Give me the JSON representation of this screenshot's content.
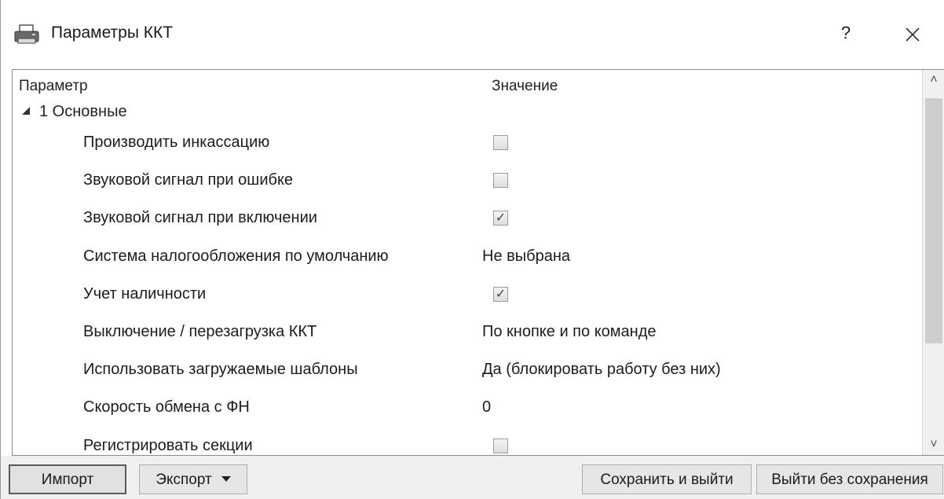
{
  "window": {
    "title": "Параметры ККТ",
    "help_label": "?"
  },
  "grid": {
    "columns": {
      "param": "Параметр",
      "value": "Значение"
    },
    "group": {
      "label": "1 Основные"
    },
    "rows": [
      {
        "label": "Производить инкассацию",
        "type": "checkbox",
        "checked": false
      },
      {
        "label": "Звуковой сигнал при ошибке",
        "type": "checkbox",
        "checked": false
      },
      {
        "label": "Звуковой сигнал при включении",
        "type": "checkbox",
        "checked": true
      },
      {
        "label": "Система налогообложения по умолчанию",
        "type": "text",
        "value": "Не выбрана"
      },
      {
        "label": "Учет наличности",
        "type": "checkbox",
        "checked": true
      },
      {
        "label": "Выключение / перезагрузка ККТ",
        "type": "text",
        "value": "По кнопке и по команде"
      },
      {
        "label": "Использовать загружаемые шаблоны",
        "type": "text",
        "value": "Да (блокировать работу без них)"
      },
      {
        "label": "Скорость обмена с ФН",
        "type": "text",
        "value": "0"
      },
      {
        "label": "Регистрировать секции",
        "type": "checkbox",
        "checked": false
      }
    ]
  },
  "footer": {
    "import_label": "Импорт",
    "export_label": "Экспорт",
    "save_exit_label": "Сохранить и выйти",
    "exit_nosave_label": "Выйти без сохранения"
  }
}
